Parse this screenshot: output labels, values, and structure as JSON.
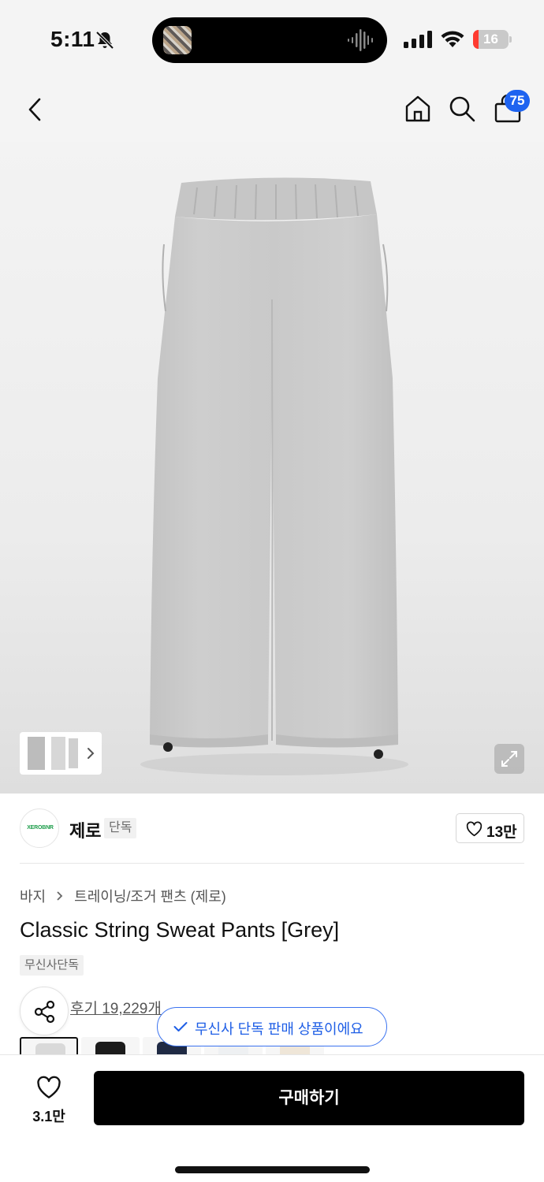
{
  "status_bar": {
    "time": "5:11",
    "battery": "16",
    "battery_level": 0.16,
    "icons": [
      "bell-slash-icon",
      "cellular-signal-icon",
      "wifi-icon",
      "battery-charging-icon"
    ]
  },
  "nav": {
    "icons": [
      "back-chevron-icon",
      "home-icon",
      "search-icon",
      "shopping-bag-icon"
    ],
    "cart_count": "75"
  },
  "hero": {
    "thumbnail_icons": [
      "chevron-right-icon"
    ],
    "expand_icon": "expand-arrows-icon"
  },
  "brand": {
    "logo_text": "XEROBNR",
    "name": "제로",
    "tag": "단독",
    "likes": "13만"
  },
  "product": {
    "breadcrumb": [
      "바지",
      "트레이닝/조거 팬츠 (제로)"
    ],
    "title": "Classic String Sweat Pants [Grey]",
    "badge": "무신사단독",
    "reviews": "후기 19,229개",
    "toast": "무신사 단독 판매 상품이에요"
  },
  "swatches": [
    {
      "color": "#d9d9d9",
      "selected": true
    },
    {
      "color": "#1c1c1c",
      "selected": false
    },
    {
      "color": "#1f2a44",
      "selected": false
    },
    {
      "color": "#eef0f2",
      "selected": false
    },
    {
      "color": "#efe6d8",
      "selected": false
    }
  ],
  "bottom": {
    "wish_count": "3.1만",
    "buy_label": "구매하기"
  }
}
